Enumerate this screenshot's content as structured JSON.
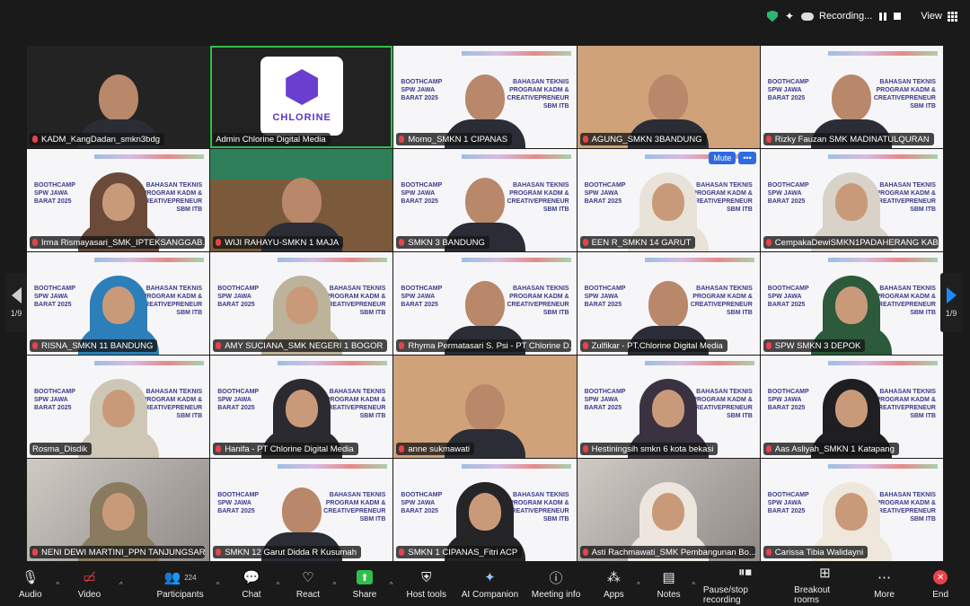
{
  "topbar": {
    "recording_label": "Recording...",
    "view_label": "View"
  },
  "pager": {
    "page_left": "1/9",
    "page_right": "1/9"
  },
  "tile_ui": {
    "mute_label": "Mute",
    "more_label": "•••"
  },
  "logo": {
    "text": "CHLORINE"
  },
  "slide_text": {
    "left": "BOOTHCAMP SPW JAWA BARAT 2025",
    "right": "BAHASAN TEKNIS PROGRAM KADM & CREATIVEPRENEUR SBM ITB"
  },
  "participants": [
    {
      "name": "KADM_KangDadan_smkn3bdg",
      "muted": true
    },
    {
      "name": "Admin Chlorine Digital Media",
      "muted": false
    },
    {
      "name": "Momo_SMKN 1 CIPANAS",
      "muted": true
    },
    {
      "name": "AGUNG_SMKN 3BANDUNG",
      "muted": true
    },
    {
      "name": "Rizky Fauzan SMK MADINATULQURAN",
      "muted": true
    },
    {
      "name": "Irma Rismayasari_SMK_IPTEKSANGGAB...",
      "muted": true
    },
    {
      "name": "WIJI RAHAYU-SMKN 1 MAJA",
      "muted": true
    },
    {
      "name": "SMKN 3 BANDUNG",
      "muted": true
    },
    {
      "name": "EEN R_SMKN 14 GARUT",
      "muted": true
    },
    {
      "name": "CempakaDewiSMKN1PADAHERANG KAB...",
      "muted": true
    },
    {
      "name": "RISNA_SMKN 11 BANDUNG",
      "muted": true
    },
    {
      "name": "AMY SUCIANA_SMK NEGERI 1 BOGOR",
      "muted": true
    },
    {
      "name": "Rhyma Permatasari S. Psi - PT Chlorine D...",
      "muted": true
    },
    {
      "name": "Zulfikar - PT.Chlorine Digital Media",
      "muted": true
    },
    {
      "name": "SPW SMKN 3 DEPOK",
      "muted": true
    },
    {
      "name": "Rosma_Disdik",
      "muted": false
    },
    {
      "name": "Hanifa - PT Chlorine Digital Media",
      "muted": true
    },
    {
      "name": "anne sukmawati",
      "muted": true
    },
    {
      "name": "Hestiningsih smkn 6 kota bekasi",
      "muted": true
    },
    {
      "name": "Aas Asliyah_SMKN 1 Katapang",
      "muted": true
    },
    {
      "name": "NENI DEWI MARTINI_PPN TANJUNGSARI",
      "muted": true
    },
    {
      "name": "SMKN 12 Garut Didda R Kusumah",
      "muted": true
    },
    {
      "name": "SMKN 1 CIPANAS_Fitri ACP",
      "muted": true
    },
    {
      "name": "Asti Rachmawati_SMK Pembangunan Bo...",
      "muted": true
    },
    {
      "name": "Carissa Tibia Walidayni",
      "muted": true
    }
  ],
  "toolbar": {
    "audio": "Audio",
    "video": "Video",
    "participants": "Participants",
    "participants_count": "224",
    "chat": "Chat",
    "react": "React",
    "share": "Share",
    "host_tools": "Host tools",
    "ai_companion": "AI Companion",
    "meeting_info": "Meeting info",
    "apps": "Apps",
    "notes": "Notes",
    "pause_stop_recording": "Pause/stop recording",
    "breakout_rooms": "Breakout rooms",
    "more": "More",
    "end": "End"
  },
  "colors": {
    "background": "#1a1a1a",
    "active_speaker": "#2fbf4a",
    "muted_mic": "#e8424b",
    "accent_blue": "#2d6ae3",
    "share_green": "#2fbf4a"
  }
}
